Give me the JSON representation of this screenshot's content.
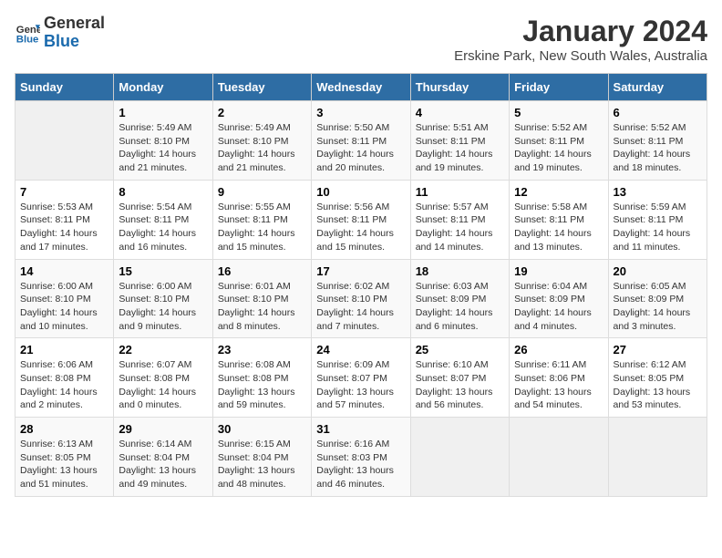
{
  "logo": {
    "general": "General",
    "blue": "Blue"
  },
  "title": "January 2024",
  "subtitle": "Erskine Park, New South Wales, Australia",
  "days_of_week": [
    "Sunday",
    "Monday",
    "Tuesday",
    "Wednesday",
    "Thursday",
    "Friday",
    "Saturday"
  ],
  "weeks": [
    [
      {
        "day": "",
        "info": ""
      },
      {
        "day": "1",
        "info": "Sunrise: 5:49 AM\nSunset: 8:10 PM\nDaylight: 14 hours\nand 21 minutes."
      },
      {
        "day": "2",
        "info": "Sunrise: 5:49 AM\nSunset: 8:10 PM\nDaylight: 14 hours\nand 21 minutes."
      },
      {
        "day": "3",
        "info": "Sunrise: 5:50 AM\nSunset: 8:11 PM\nDaylight: 14 hours\nand 20 minutes."
      },
      {
        "day": "4",
        "info": "Sunrise: 5:51 AM\nSunset: 8:11 PM\nDaylight: 14 hours\nand 19 minutes."
      },
      {
        "day": "5",
        "info": "Sunrise: 5:52 AM\nSunset: 8:11 PM\nDaylight: 14 hours\nand 19 minutes."
      },
      {
        "day": "6",
        "info": "Sunrise: 5:52 AM\nSunset: 8:11 PM\nDaylight: 14 hours\nand 18 minutes."
      }
    ],
    [
      {
        "day": "7",
        "info": "Sunrise: 5:53 AM\nSunset: 8:11 PM\nDaylight: 14 hours\nand 17 minutes."
      },
      {
        "day": "8",
        "info": "Sunrise: 5:54 AM\nSunset: 8:11 PM\nDaylight: 14 hours\nand 16 minutes."
      },
      {
        "day": "9",
        "info": "Sunrise: 5:55 AM\nSunset: 8:11 PM\nDaylight: 14 hours\nand 15 minutes."
      },
      {
        "day": "10",
        "info": "Sunrise: 5:56 AM\nSunset: 8:11 PM\nDaylight: 14 hours\nand 15 minutes."
      },
      {
        "day": "11",
        "info": "Sunrise: 5:57 AM\nSunset: 8:11 PM\nDaylight: 14 hours\nand 14 minutes."
      },
      {
        "day": "12",
        "info": "Sunrise: 5:58 AM\nSunset: 8:11 PM\nDaylight: 14 hours\nand 13 minutes."
      },
      {
        "day": "13",
        "info": "Sunrise: 5:59 AM\nSunset: 8:11 PM\nDaylight: 14 hours\nand 11 minutes."
      }
    ],
    [
      {
        "day": "14",
        "info": "Sunrise: 6:00 AM\nSunset: 8:10 PM\nDaylight: 14 hours\nand 10 minutes."
      },
      {
        "day": "15",
        "info": "Sunrise: 6:00 AM\nSunset: 8:10 PM\nDaylight: 14 hours\nand 9 minutes."
      },
      {
        "day": "16",
        "info": "Sunrise: 6:01 AM\nSunset: 8:10 PM\nDaylight: 14 hours\nand 8 minutes."
      },
      {
        "day": "17",
        "info": "Sunrise: 6:02 AM\nSunset: 8:10 PM\nDaylight: 14 hours\nand 7 minutes."
      },
      {
        "day": "18",
        "info": "Sunrise: 6:03 AM\nSunset: 8:09 PM\nDaylight: 14 hours\nand 6 minutes."
      },
      {
        "day": "19",
        "info": "Sunrise: 6:04 AM\nSunset: 8:09 PM\nDaylight: 14 hours\nand 4 minutes."
      },
      {
        "day": "20",
        "info": "Sunrise: 6:05 AM\nSunset: 8:09 PM\nDaylight: 14 hours\nand 3 minutes."
      }
    ],
    [
      {
        "day": "21",
        "info": "Sunrise: 6:06 AM\nSunset: 8:08 PM\nDaylight: 14 hours\nand 2 minutes."
      },
      {
        "day": "22",
        "info": "Sunrise: 6:07 AM\nSunset: 8:08 PM\nDaylight: 14 hours\nand 0 minutes."
      },
      {
        "day": "23",
        "info": "Sunrise: 6:08 AM\nSunset: 8:08 PM\nDaylight: 13 hours\nand 59 minutes."
      },
      {
        "day": "24",
        "info": "Sunrise: 6:09 AM\nSunset: 8:07 PM\nDaylight: 13 hours\nand 57 minutes."
      },
      {
        "day": "25",
        "info": "Sunrise: 6:10 AM\nSunset: 8:07 PM\nDaylight: 13 hours\nand 56 minutes."
      },
      {
        "day": "26",
        "info": "Sunrise: 6:11 AM\nSunset: 8:06 PM\nDaylight: 13 hours\nand 54 minutes."
      },
      {
        "day": "27",
        "info": "Sunrise: 6:12 AM\nSunset: 8:05 PM\nDaylight: 13 hours\nand 53 minutes."
      }
    ],
    [
      {
        "day": "28",
        "info": "Sunrise: 6:13 AM\nSunset: 8:05 PM\nDaylight: 13 hours\nand 51 minutes."
      },
      {
        "day": "29",
        "info": "Sunrise: 6:14 AM\nSunset: 8:04 PM\nDaylight: 13 hours\nand 49 minutes."
      },
      {
        "day": "30",
        "info": "Sunrise: 6:15 AM\nSunset: 8:04 PM\nDaylight: 13 hours\nand 48 minutes."
      },
      {
        "day": "31",
        "info": "Sunrise: 6:16 AM\nSunset: 8:03 PM\nDaylight: 13 hours\nand 46 minutes."
      },
      {
        "day": "",
        "info": ""
      },
      {
        "day": "",
        "info": ""
      },
      {
        "day": "",
        "info": ""
      }
    ]
  ]
}
